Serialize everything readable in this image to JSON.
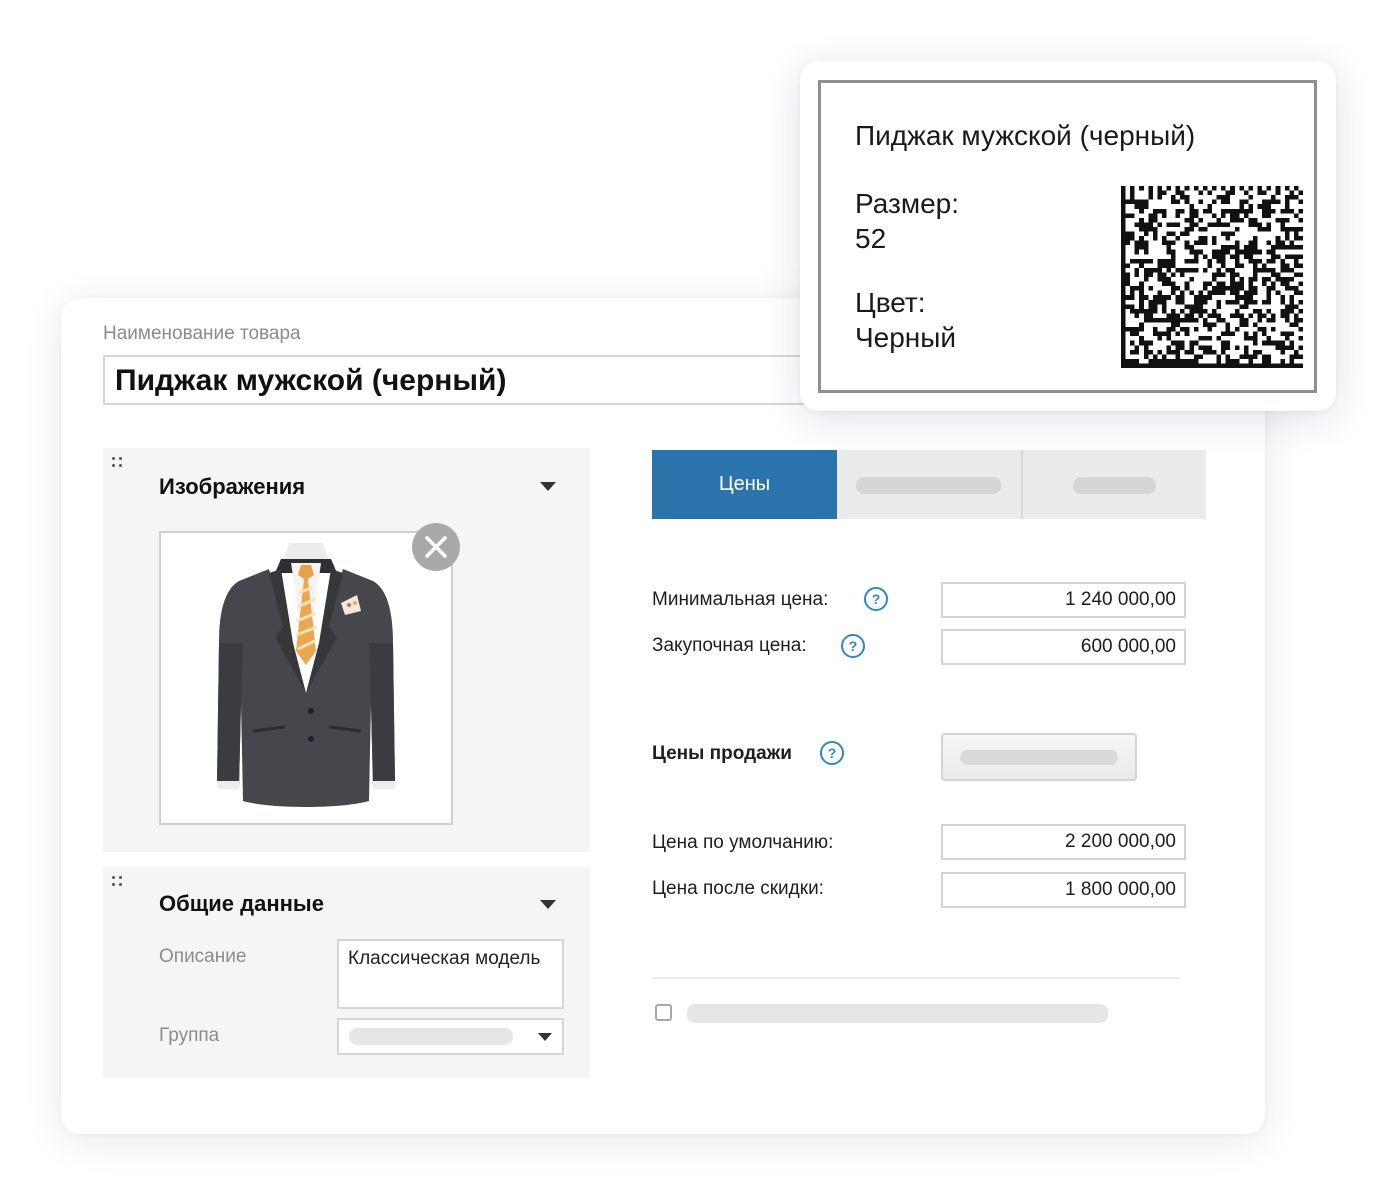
{
  "product_name": {
    "label": "Наименование товара",
    "value": "Пиджак мужской (черный)"
  },
  "images_panel": {
    "title": "Изображения",
    "image_alt": "Пиджак мужской"
  },
  "general_panel": {
    "title": "Общие данные",
    "description_label": "Описание",
    "description_value": "Классическая модель",
    "group_label": "Группа"
  },
  "tabs": [
    {
      "label": "Цены",
      "active": true
    },
    {
      "label": "",
      "active": false
    },
    {
      "label": "",
      "active": false
    }
  ],
  "prices": {
    "min_price_label": "Минимальная цена:",
    "min_price_value": "1 240 000,00",
    "purchase_price_label": "Закупочная цена:",
    "purchase_price_value": "600 000,00",
    "sale_prices_label": "Цены продажи",
    "default_price_label": "Цена по умолчанию:",
    "default_price_value": "2 200 000,00",
    "discount_price_label": "Цена после скидки:",
    "discount_price_value": "1 800 000,00",
    "help_glyph": "?"
  },
  "price_tag": {
    "title": "Пиджак мужской (черный)",
    "size_label": "Размер:",
    "size_value": "52",
    "color_label": "Цвет:",
    "color_value": "Черный"
  },
  "colors": {
    "accent": "#2b73ab",
    "help": "#2e87c9",
    "panel_bg": "#f5f5f5"
  }
}
